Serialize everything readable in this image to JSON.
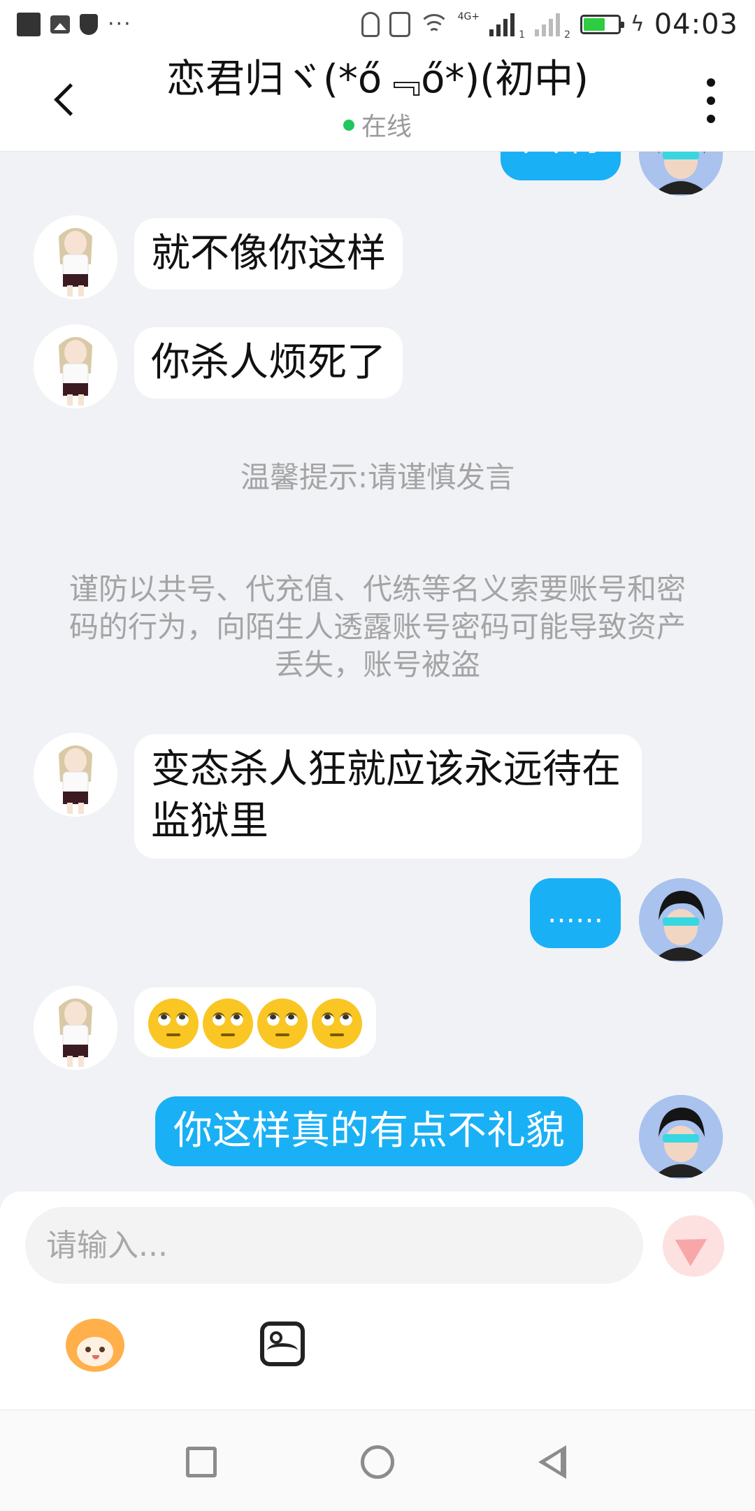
{
  "status_bar": {
    "time": "04:03",
    "network": "4G+",
    "sim1": "1",
    "sim2": "2"
  },
  "header": {
    "title": "恋君归ヾ(*ő﹃ő*)(初中)",
    "status": "在线"
  },
  "messages": [
    {
      "side": "out",
      "text": "大啊"
    },
    {
      "side": "in",
      "text": "就不像你这样"
    },
    {
      "side": "in",
      "text": "你杀人烦死了"
    },
    {
      "side": "in",
      "text": "变态杀人狂就应该永远待在监狱里"
    },
    {
      "side": "out",
      "text": "……"
    },
    {
      "side": "in",
      "emoji": [
        "eye-roll-emoji",
        "eye-roll-emoji",
        "eye-roll-emoji",
        "eye-roll-emoji"
      ]
    },
    {
      "side": "out",
      "text": "你这样真的有点不礼貌"
    }
  ],
  "notices": {
    "tip": "温馨提示:请谨慎发言",
    "warning": "谨防以共号、代充值、代练等名义索要账号和密码的行为，向陌生人透露账号密码可能导致资产丢失，账号被盗"
  },
  "input": {
    "placeholder": "请输入..."
  },
  "colors": {
    "outgoing_bubble": "#1ab0f5",
    "incoming_bubble": "#ffffff",
    "background": "#f1f2f6",
    "online_dot": "#22c55e"
  },
  "icons": [
    "back-arrow-icon",
    "more-options-icon",
    "send-icon",
    "emoji-mascot-icon",
    "image-icon"
  ]
}
